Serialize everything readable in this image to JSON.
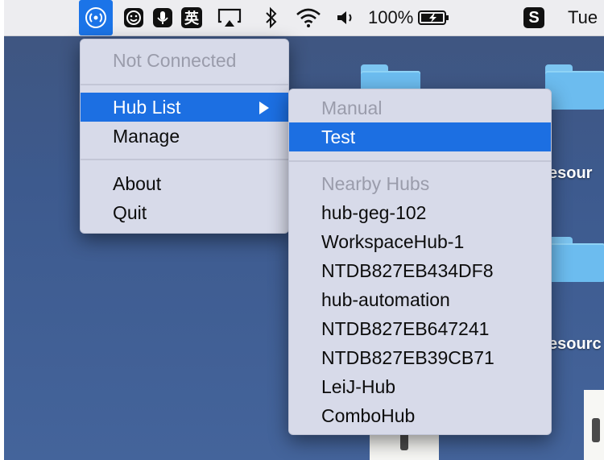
{
  "menubar": {
    "items": [
      {
        "name": "hub-status-icon",
        "glyph": "(•)"
      },
      {
        "name": "smiley-icon",
        "glyph": "☺"
      },
      {
        "name": "microphone-icon",
        "glyph": "🎙"
      },
      {
        "name": "input-method-icon",
        "glyph": "英"
      },
      {
        "name": "airplay-icon",
        "glyph": ""
      },
      {
        "name": "bluetooth-icon",
        "glyph": "✱"
      },
      {
        "name": "wifi-icon",
        "glyph": ""
      },
      {
        "name": "volume-icon",
        "glyph": "🔈"
      }
    ],
    "battery_text": "100%",
    "app_icon": "S",
    "day_text": "Tue"
  },
  "status_menu": {
    "header": "Not Connected",
    "hub_list_label": "Hub List",
    "manage_label": "Manage",
    "about_label": "About",
    "quit_label": "Quit"
  },
  "hub_menu": {
    "manual_header": "Manual",
    "manual_items": [
      "Test"
    ],
    "nearby_header": "Nearby Hubs",
    "nearby_items": [
      "hub-geg-102",
      "WorkspaceHub-1",
      "NTDB827EB434DF8",
      "hub-automation",
      "NTDB827EB647241",
      "NTDB827EB39CB71",
      "LeiJ-Hub",
      "ComboHub"
    ]
  },
  "desktop": {
    "label_1": "esour",
    "label_2": "esourc"
  },
  "colors": {
    "menubar_bg": "#ededf0",
    "highlight": "#1c6fe2",
    "menu_bg": "#d7dae9",
    "desktop": "#3f5681"
  }
}
